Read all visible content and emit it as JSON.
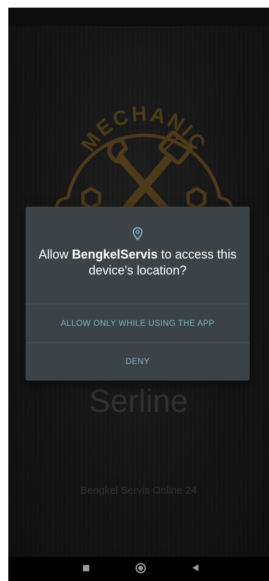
{
  "app": {
    "logo_text": "MECHANIC",
    "title": "Serline",
    "subtitle": "Bengkel Servis Online 24"
  },
  "dialog": {
    "icon": "location-pin-icon",
    "title_prefix": "Allow ",
    "app_name": "BengkelServis",
    "title_suffix": " to access this device's location?",
    "allow_button": "ALLOW ONLY WHILE USING THE APP",
    "deny_button": "DENY"
  },
  "nav": {
    "icons": [
      "recents-icon",
      "home-icon",
      "back-icon"
    ]
  },
  "colors": {
    "dialog_bg": "#3b4347",
    "accent": "#7fb6c4",
    "logo_gold": "#8a6a2e",
    "dim_text": "#5a5a5a"
  }
}
